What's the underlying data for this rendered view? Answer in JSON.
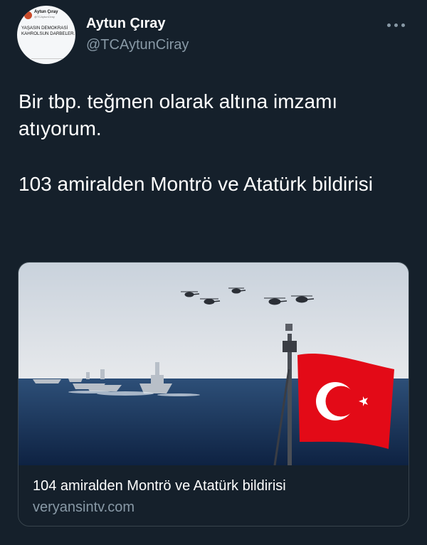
{
  "author": {
    "display_name": "Aytun Çıray",
    "handle": "@TCAytunCiray"
  },
  "avatar": {
    "mini_name": "Aytun Çıray",
    "mini_handle": "@TCAytunCiray",
    "mini_text": "YAŞASIN DEMOKRASİ KAHROLSUN DARBELER."
  },
  "tweet": {
    "paragraph_1": "Bir tbp. teğmen olarak altına imzamı atıyorum.",
    "paragraph_2": "103 amiralden Montrö ve Atatürk bildirisi"
  },
  "card": {
    "title": "104 amiralden Montrö ve Atatürk bildirisi",
    "domain": "veryansintv.com",
    "image_subject": "naval-fleet-helicopters-turkish-flag"
  },
  "icons": {
    "more": "more-horizontal-icon"
  },
  "colors": {
    "background": "#15202b",
    "secondary_text": "#8899a6",
    "border": "#38444d",
    "flag_red": "#e30a17"
  }
}
